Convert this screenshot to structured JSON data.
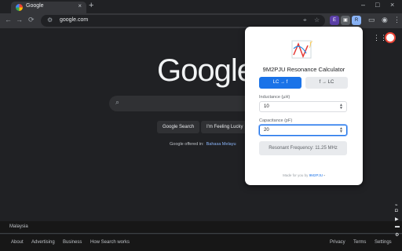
{
  "browser": {
    "tab_title": "Google",
    "tab_close_icon": "close-icon",
    "new_tab_label": "+",
    "window_controls": [
      "–",
      "□"
    ],
    "nav_back": "←",
    "nav_forward": "→",
    "nav_reload": "C",
    "url": "google.com",
    "ext_badge": "E",
    "ext_active_label": "R"
  },
  "page": {
    "logo": "Google",
    "search_button": "Google Search",
    "lucky_button": "I'm Feeling Lucky",
    "offered_in_label": "Google offered in:",
    "offered_in_language": "Bahasa Melayu",
    "country": "Malaysia",
    "footer_left": [
      "About",
      "Advertising",
      "Business",
      "How Search works"
    ],
    "footer_right": [
      "Privacy",
      "Terms",
      "Settings"
    ]
  },
  "popup": {
    "title": "9M2PJU Resonance Calculator",
    "mode_lc_to_f": "LC → f",
    "mode_f_to_lc": "f → LC",
    "inductance_label": "Inductance (µH)",
    "inductance_value": "10",
    "capacitance_label": "Capacitance (pF)",
    "capacitance_value": "20",
    "result": "Resonant Frequency: 11.25 MHz",
    "made_by_prefix": "Made for you by",
    "made_by_link": "9M2PJU",
    "accent_color": "#1a73e8"
  }
}
